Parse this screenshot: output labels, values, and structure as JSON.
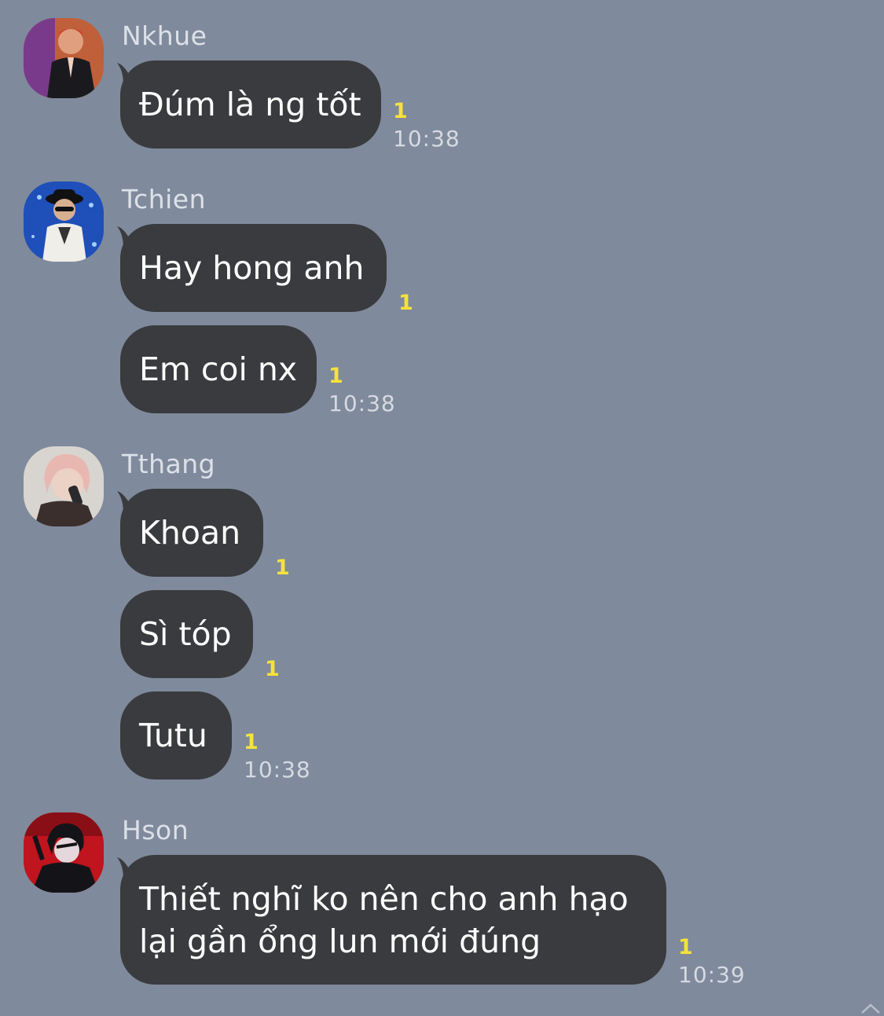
{
  "messages": [
    {
      "sender": "Nkhue",
      "bubbles": [
        {
          "text": "Đúm là ng tốt",
          "unread": "1",
          "time": "10:38"
        }
      ]
    },
    {
      "sender": "Tchien",
      "bubbles": [
        {
          "text": "Hay hong anh",
          "unread": "1",
          "time": ""
        },
        {
          "text": "Em coi nx",
          "unread": "1",
          "time": "10:38"
        }
      ]
    },
    {
      "sender": "Tthang",
      "bubbles": [
        {
          "text": "Khoan",
          "unread": "1",
          "time": ""
        },
        {
          "text": "Sì tóp",
          "unread": "1",
          "time": ""
        },
        {
          "text": "Tutu",
          "unread": "1",
          "time": "10:38"
        }
      ]
    },
    {
      "sender": "Hson",
      "bubbles": [
        {
          "line1": "Thiết nghĩ ko nên cho anh hạo",
          "line2": "lại gần ổng lun mới đúng",
          "unread": "1",
          "time": "10:39"
        }
      ]
    }
  ],
  "colors": {
    "background": "#7f8a9c",
    "bubble": "#3a3b3e",
    "unread": "#f5e23a",
    "sender_text": "#dce1e9"
  }
}
